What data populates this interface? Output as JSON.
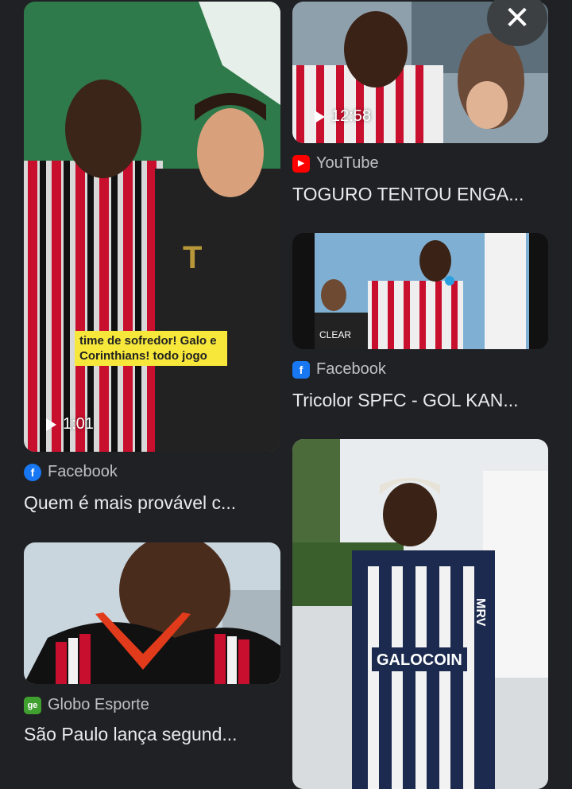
{
  "results": [
    {
      "duration": "1:01",
      "caption": "time de sofredor! Galo e Corinthians! todo jogo",
      "source": "Facebook",
      "source_icon": "facebook-icon",
      "title": "Quem é mais provável c..."
    },
    {
      "duration": "12:58",
      "source": "YouTube",
      "source_icon": "youtube-icon",
      "title": "TOGURO TENTOU ENGA..."
    },
    {
      "source": "Facebook",
      "source_icon": "facebook-icon",
      "title": "Tricolor SPFC - GOL KAN...",
      "thumb_text": "CLEAR"
    },
    {
      "source": "Globo Esporte",
      "source_icon": "globo-esporte-icon",
      "title": "São Paulo lança segund..."
    },
    {
      "thumb_text": "GALOCOIN",
      "thumb_text_2": "MRV"
    }
  ],
  "close_label": "✕",
  "icons": {
    "facebook": "f",
    "youtube": "▶",
    "globo": "ge"
  },
  "colors": {
    "background": "#202124",
    "facebook": "#1877f2",
    "youtube": "#ff0000",
    "globo": "#3fa02f"
  }
}
